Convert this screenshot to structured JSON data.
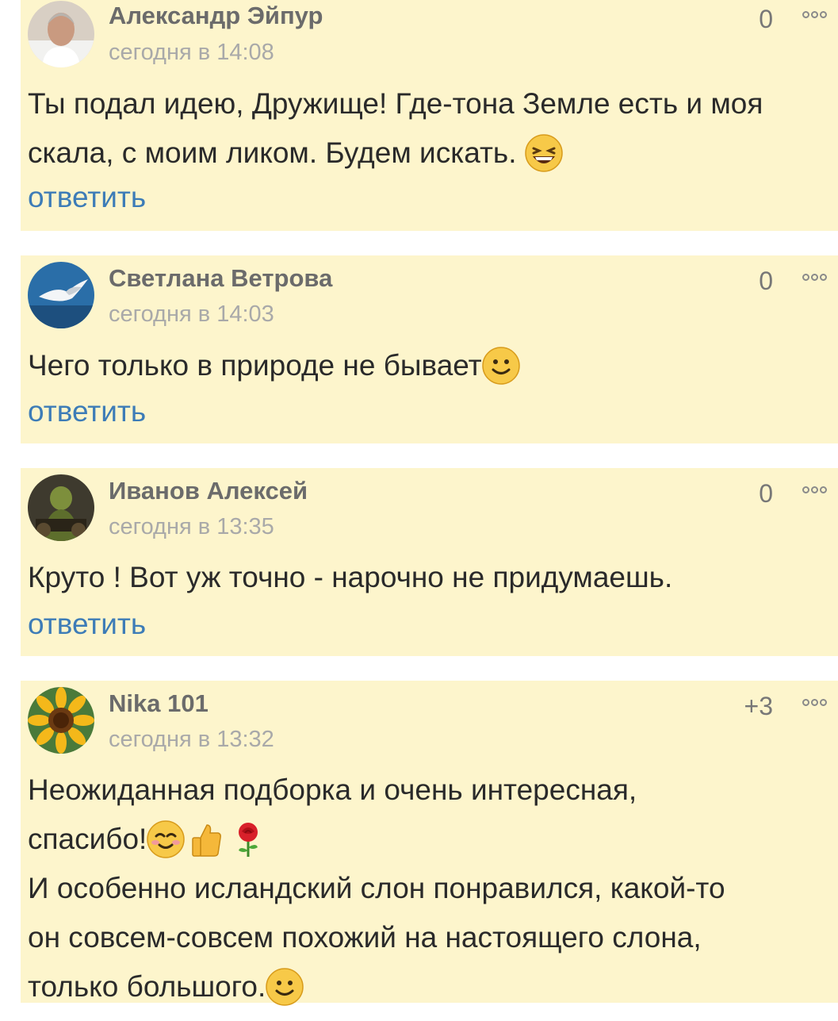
{
  "comments": [
    {
      "author": "Александр Эйпур",
      "time": "сегодня в 14:08",
      "rating": "0",
      "text": "Ты подал идею, Дружище! Где-тона Земле есть и моя скала, с моим ликом. Будем искать.",
      "reply": "ответить"
    },
    {
      "author": "Светлана Ветрова",
      "time": "сегодня в 14:03",
      "rating": "0",
      "text": "Чего только в природе не бывает",
      "reply": "ответить"
    },
    {
      "author": "Иванов Алексей",
      "time": "сегодня в 13:35",
      "rating": "0",
      "text": "Круто ! Вот уж точно - нарочно не придумаешь.",
      "reply": "ответить"
    },
    {
      "author": "Nika 101",
      "time": "сегодня в 13:32",
      "rating": "+3",
      "text_line1": "Неожиданная подборка и очень интересная,",
      "text_line2": "спасибо!",
      "text_line3": "И особенно исландский слон понравился, какой-то",
      "text_line4": "он совсем-совсем похожий на настоящего слона,",
      "text_line5": "только большого."
    }
  ],
  "icons": {
    "more": "more-options-icon",
    "laugh": "laughing-emoji-icon",
    "smile": "smile-emoji-icon",
    "blush": "blush-emoji-icon",
    "thumbs": "thumbs-up-icon",
    "rose": "rose-icon"
  }
}
